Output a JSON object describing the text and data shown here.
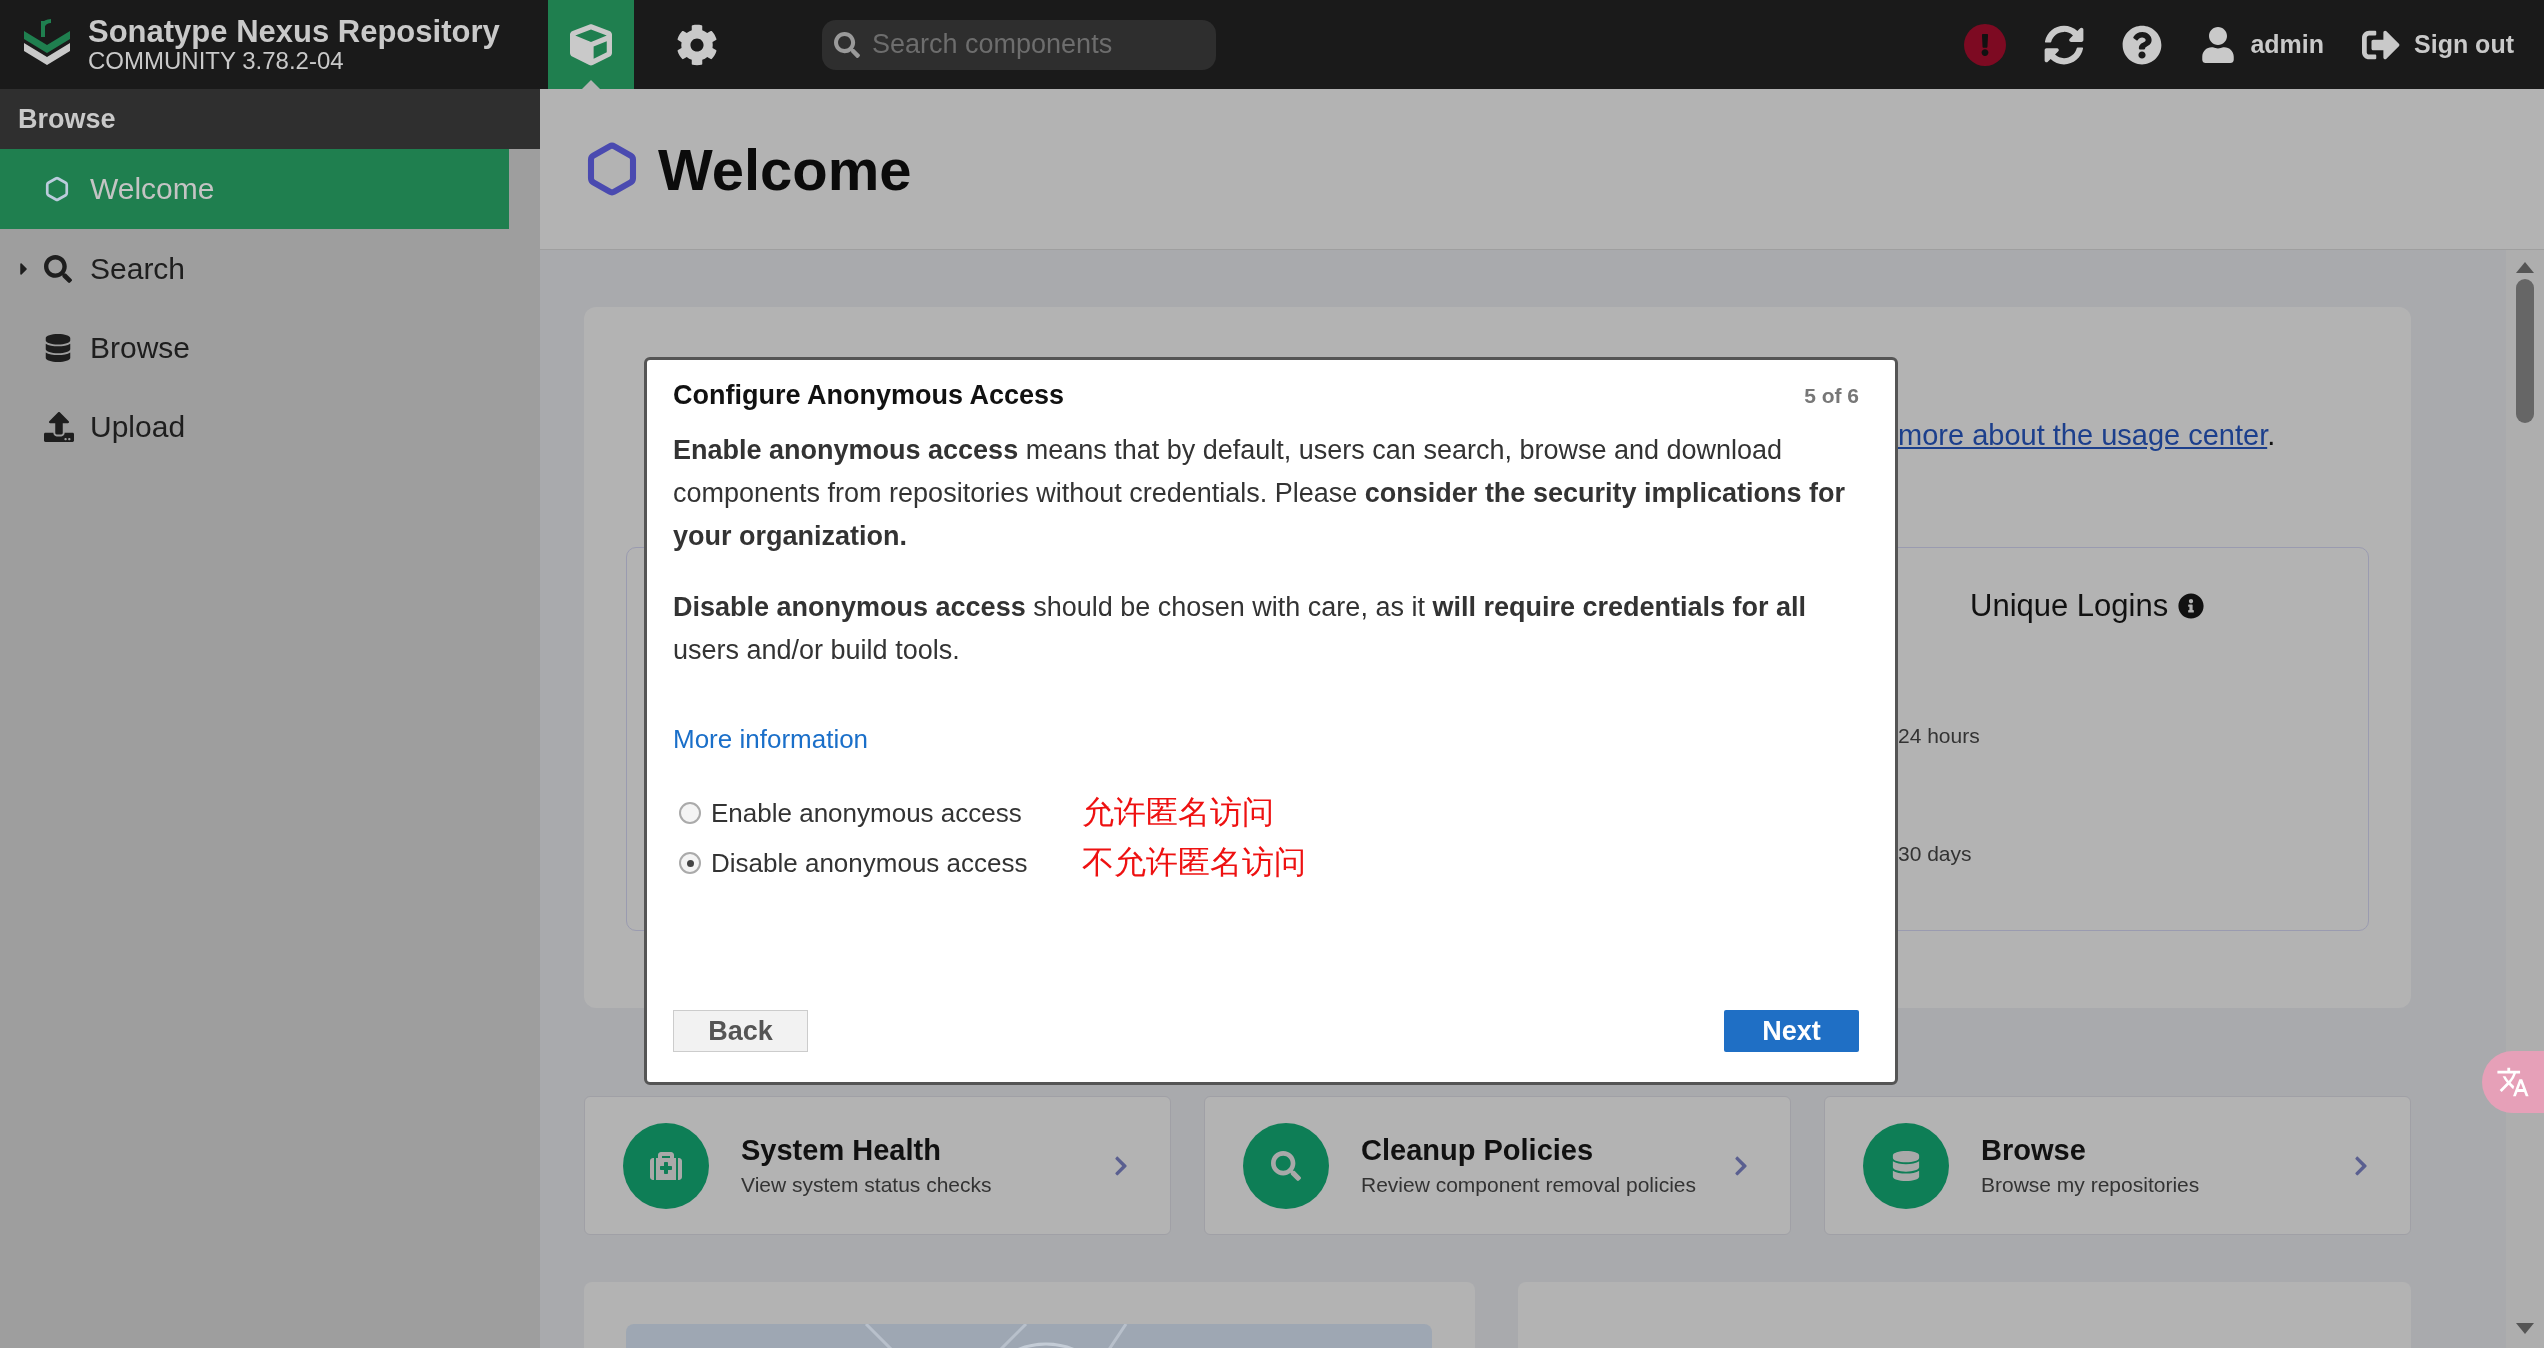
{
  "header": {
    "product": "Sonatype Nexus Repository",
    "edition": "COMMUNITY 3.78.2-04",
    "nav": [
      {
        "kind": "browse",
        "selected": true
      },
      {
        "kind": "admin",
        "selected": false
      }
    ],
    "search": {
      "placeholder": "Search components"
    },
    "user": "admin",
    "sign_out": "Sign out"
  },
  "sidebar": {
    "heading": "Browse",
    "items": [
      {
        "kind": "welcome",
        "label": "Welcome",
        "selected": true,
        "expandable": false
      },
      {
        "kind": "search",
        "label": "Search",
        "selected": false,
        "expandable": true
      },
      {
        "kind": "browse",
        "label": "Browse",
        "selected": false,
        "expandable": false
      },
      {
        "kind": "upload",
        "label": "Upload",
        "selected": false,
        "expandable": false
      }
    ]
  },
  "page": {
    "title": "Welcome"
  },
  "usage": {
    "link": "more about the usage center",
    "after_link": ".",
    "logins_title": "Unique Logins",
    "logins_rows": [
      "24 hours",
      "30 days"
    ]
  },
  "dialog": {
    "title": "Configure Anonymous Access",
    "step": "5 of 6",
    "paragraphs": [
      "**Enable anonymous access** means that by default, users can search, browse and download components from repositories without credentials. Please **consider the security implications for your organization.**",
      "**Disable anonymous access** should be chosen with care, as it **will require credentials for all** users and/or build tools."
    ],
    "link": "More information",
    "options": [
      {
        "label": "Enable anonymous access",
        "note": "允许匿名访问",
        "selected": false
      },
      {
        "label": "Disable anonymous access",
        "note": "不允许匿名访问",
        "selected": true
      }
    ],
    "back": "Back",
    "next": "Next"
  },
  "shortcuts": [
    {
      "kind": "health",
      "title": "System Health",
      "subtitle": "View system status checks"
    },
    {
      "kind": "cleanup",
      "title": "Cleanup Policies",
      "subtitle": "Review component removal policies"
    },
    {
      "kind": "browse",
      "title": "Browse",
      "subtitle": "Browse my repositories"
    }
  ]
}
